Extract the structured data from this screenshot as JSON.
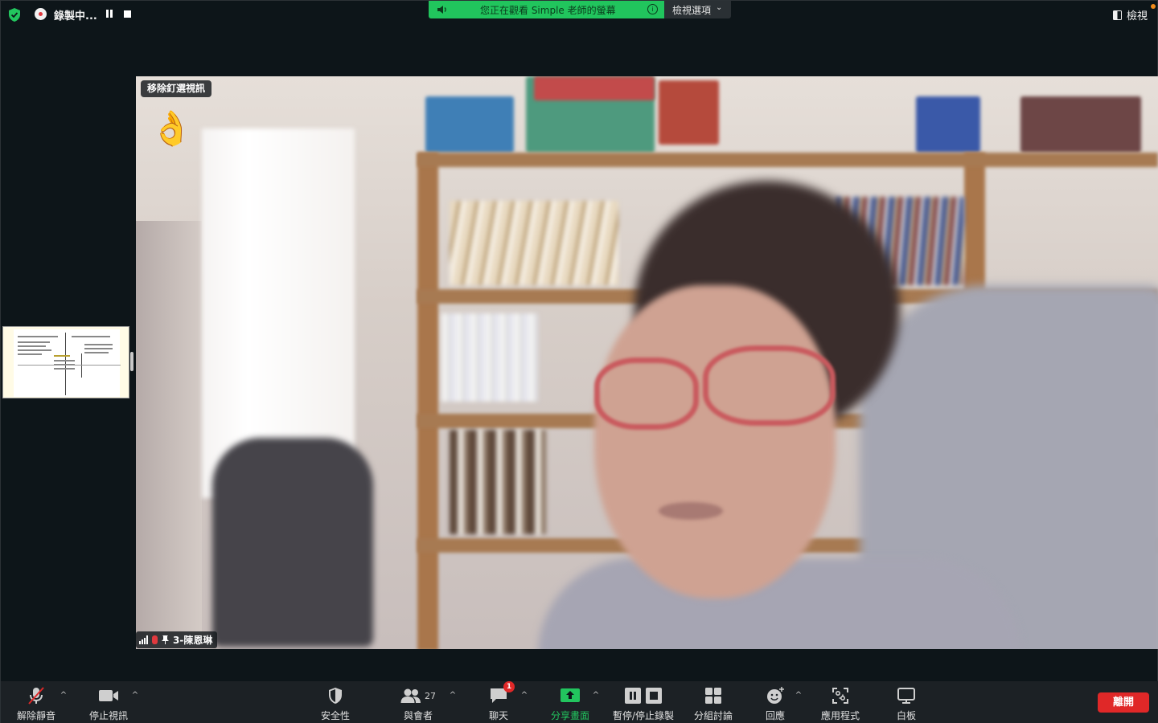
{
  "topbar": {
    "recording_label": "錄製中...",
    "share_banner_text": "您正在觀看 Simple 老師的螢幕",
    "view_options_label": "檢視選項",
    "view_label": "檢視"
  },
  "video": {
    "unpin_label": "移除釘選視訊",
    "reaction_emoji": "👌",
    "participant_name": "3-陳恩琳"
  },
  "toolbar": {
    "unmute_label": "解除靜音",
    "stop_video_label": "停止視訊",
    "security_label": "安全性",
    "participants_label": "與會者",
    "participants_count": "27",
    "chat_label": "聊天",
    "chat_badge": "1",
    "share_screen_label": "分享畫面",
    "pause_stop_recording_label": "暫停/停止錄製",
    "breakout_label": "分組討論",
    "reactions_label": "回應",
    "apps_label": "應用程式",
    "whiteboard_label": "白板",
    "leave_label": "離開"
  },
  "colors": {
    "accent_green": "#22c55e",
    "leave_red": "#e02828",
    "toolbar_bg": "#1c2125",
    "badge_orange": "#f28c1b"
  },
  "icons": [
    "shield-icon",
    "record-icon",
    "pause-icon",
    "stop-icon",
    "speaker-icon",
    "info-icon",
    "chevron-down-icon",
    "view-icon",
    "mic-off-icon",
    "video-camera-icon",
    "security-shield-icon",
    "participants-icon",
    "chat-icon",
    "share-screen-icon",
    "pause-record-icon",
    "breakout-rooms-icon",
    "reactions-icon",
    "apps-icon",
    "whiteboard-icon",
    "signal-icon",
    "pin-icon"
  ]
}
